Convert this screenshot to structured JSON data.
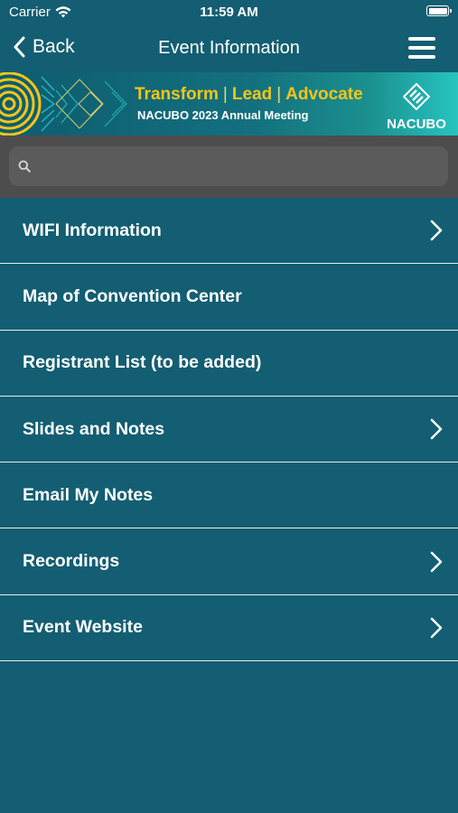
{
  "status_bar": {
    "carrier": "Carrier",
    "time": "11:59 AM"
  },
  "nav": {
    "back_label": "Back",
    "title": "Event Information"
  },
  "banner": {
    "tagline_1": "Transform",
    "tagline_2": "Lead",
    "tagline_3": "Advocate",
    "subtitle": "NACUBO 2023 Annual Meeting",
    "logo_text": "NACUBO"
  },
  "search": {
    "placeholder": "",
    "value": ""
  },
  "menu_items": [
    {
      "label": "WIFI Information",
      "has_chevron": true
    },
    {
      "label": "Map of Convention Center",
      "has_chevron": false
    },
    {
      "label": "Registrant List (to be added)",
      "has_chevron": false
    },
    {
      "label": "Slides and Notes",
      "has_chevron": true
    },
    {
      "label": "Email My Notes",
      "has_chevron": false
    },
    {
      "label": "Recordings",
      "has_chevron": true
    },
    {
      "label": "Event Website",
      "has_chevron": true
    }
  ],
  "colors": {
    "background": "#135e72",
    "search_bar_bg": "#4d4d4d",
    "search_field_bg": "#5b5b5b",
    "banner_accent": "#f5c518",
    "divider": "#e9eef0"
  },
  "icons": {
    "wifi": "wifi-icon",
    "battery": "battery-icon",
    "back": "chevron-left-icon",
    "menu": "hamburger-menu-icon",
    "search": "search-icon",
    "row": "chevron-right-icon"
  }
}
